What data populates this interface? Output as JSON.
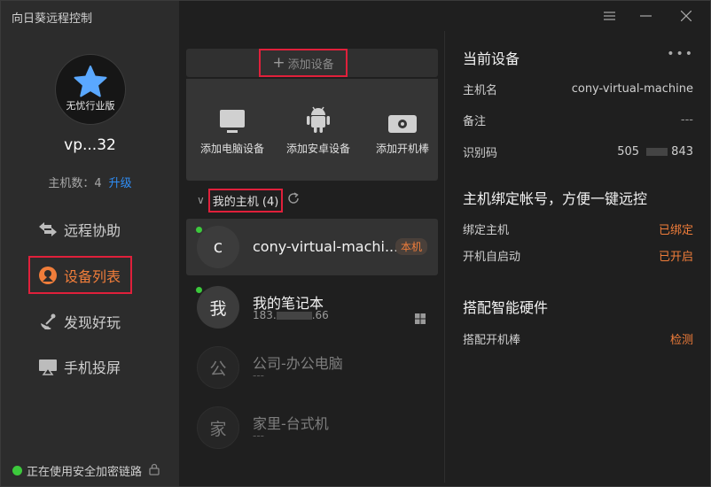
{
  "app": {
    "title": "向日葵远程控制"
  },
  "sidebar": {
    "plan": "无忧行业版",
    "username": "vp...32",
    "host_count_label": "主机数：4",
    "upgrade": "升级",
    "nav": [
      {
        "label": "远程协助",
        "icon": "remote-assist-icon"
      },
      {
        "label": "设备列表",
        "icon": "device-list-icon"
      },
      {
        "label": "发现好玩",
        "icon": "discover-icon"
      },
      {
        "label": "手机投屏",
        "icon": "screen-cast-icon"
      }
    ],
    "secure_text": "正在使用安全加密链路"
  },
  "middle": {
    "add_device": "添加设备",
    "add_options": [
      {
        "label": "添加电脑设备",
        "icon": "monitor-icon"
      },
      {
        "label": "添加安卓设备",
        "icon": "android-icon"
      },
      {
        "label": "添加开机棒",
        "icon": "boot-stick-icon"
      }
    ],
    "group_label": "我的主机 (4)",
    "devices": [
      {
        "initial": "c",
        "name": "cony-virtual-machi...",
        "badge": "本机",
        "online": true
      },
      {
        "initial": "我",
        "name": "我的笔记本",
        "sub_prefix": "183.",
        "sub_suffix": ".66",
        "online": true
      },
      {
        "initial": "公",
        "name": "公司-办公电脑",
        "sub": "---",
        "online": false
      },
      {
        "initial": "家",
        "name": "家里-台式机",
        "sub": "---",
        "online": false
      }
    ]
  },
  "right": {
    "current_title": "当前设备",
    "more": "•••",
    "host_name_key": "主机名",
    "host_name_value": "cony-virtual-machine",
    "note_key": "备注",
    "note_value": "---",
    "id_key": "识别码",
    "id_prefix": "505",
    "id_suffix": "843",
    "bind_title": "主机绑定帐号，方便一键远控",
    "bind_host_key": "绑定主机",
    "bind_host_value": "已绑定",
    "autostart_key": "开机自启动",
    "autostart_value": "已开启",
    "hardware_title": "搭配智能硬件",
    "boot_stick_key": "搭配开机棒",
    "boot_stick_value": "检测"
  },
  "colors": {
    "accent": "#f07d3a",
    "highlight": "#e0203b",
    "online": "#3cc93c",
    "link": "#2f8df5"
  }
}
